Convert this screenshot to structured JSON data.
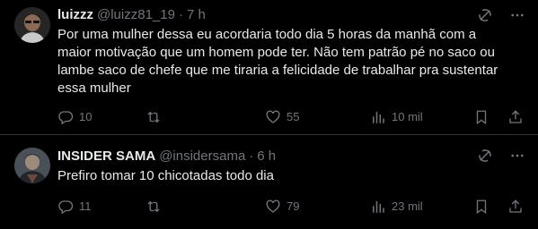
{
  "tweets": [
    {
      "name": "luizzz",
      "handle": "@luizz81_19",
      "separator": "·",
      "time": "7 h",
      "text": "Por uma mulher dessa eu acordaria todo dia 5 horas da manhã com a maior motivação que um homem pode ter. Não tem patrão pé no saco ou lambe saco de chefe que me tiraria a felicidade de trabalhar pra sustentar essa mulher",
      "replies": "10",
      "retweets": "",
      "likes": "55",
      "views": "10 mil",
      "icons": [
        "grok-icon",
        "more-icon",
        "reply-icon",
        "retweet-icon",
        "like-icon",
        "views-icon",
        "bookmark-icon",
        "share-icon"
      ]
    },
    {
      "name": "INSIDER SAMA",
      "handle": "@insidersama",
      "separator": "·",
      "time": "6 h",
      "text": "Prefiro tomar 10 chicotadas todo dia",
      "replies": "11",
      "retweets": "",
      "likes": "79",
      "views": "23 mil",
      "icons": [
        "grok-icon",
        "more-icon",
        "reply-icon",
        "retweet-icon",
        "like-icon",
        "views-icon",
        "bookmark-icon",
        "share-icon"
      ]
    }
  ],
  "colors": {
    "background": "#000000",
    "text": "#e7e9ea",
    "secondary": "#71767b",
    "divider": "#2f3336"
  }
}
